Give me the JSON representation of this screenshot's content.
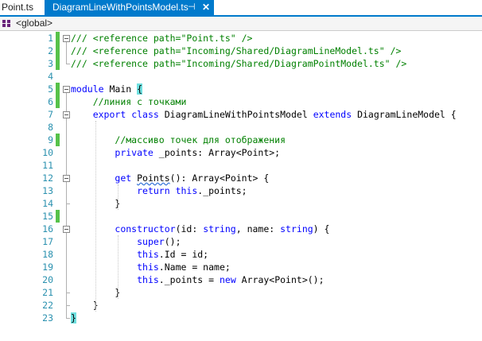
{
  "tabs": [
    {
      "label": "Point.ts",
      "active": false
    },
    {
      "label": "DiagramLineWithPointsModel.ts",
      "active": true,
      "pin": "⊣",
      "close": "✕"
    }
  ],
  "navbar": {
    "scope": "<global>"
  },
  "colors": {
    "keyword": "#0000ff",
    "comment": "#008000",
    "text": "#000000",
    "line_number": "#2b91af",
    "accent": "#007acc",
    "changed": "#57c24a"
  },
  "lines": [
    {
      "n": "1",
      "changed": true,
      "tokens": [
        [
          "c",
          "/// <reference path=\"Point.ts\" />"
        ]
      ]
    },
    {
      "n": "2",
      "changed": true,
      "tokens": [
        [
          "c",
          "/// <reference path=\"Incoming/Shared/DiagramLineModel.ts\" />"
        ]
      ]
    },
    {
      "n": "3",
      "changed": true,
      "tokens": [
        [
          "c",
          "/// <reference path=\"Incoming/Shared/DiagramPointModel.ts\" />"
        ]
      ]
    },
    {
      "n": "4",
      "changed": false,
      "tokens": []
    },
    {
      "n": "5",
      "changed": true,
      "tokens": [
        [
          "k",
          "module"
        ],
        [
          "t",
          " Main "
        ],
        [
          "b",
          "{"
        ]
      ]
    },
    {
      "n": "6",
      "changed": true,
      "tokens": [
        [
          "t",
          "    "
        ],
        [
          "c",
          "//линия с точками"
        ]
      ]
    },
    {
      "n": "7",
      "changed": false,
      "tokens": [
        [
          "t",
          "    "
        ],
        [
          "k",
          "export"
        ],
        [
          "t",
          " "
        ],
        [
          "k",
          "class"
        ],
        [
          "t",
          " DiagramLineWithPointsModel "
        ],
        [
          "k",
          "extends"
        ],
        [
          "t",
          " DiagramLineModel {"
        ]
      ]
    },
    {
      "n": "8",
      "changed": false,
      "tokens": []
    },
    {
      "n": "9",
      "changed": true,
      "tokens": [
        [
          "t",
          "        "
        ],
        [
          "c",
          "//массиво точек для отображения"
        ]
      ]
    },
    {
      "n": "10",
      "changed": false,
      "tokens": [
        [
          "t",
          "        "
        ],
        [
          "k",
          "private"
        ],
        [
          "t",
          " _points: Array<Point>;"
        ]
      ]
    },
    {
      "n": "11",
      "changed": false,
      "tokens": []
    },
    {
      "n": "12",
      "changed": false,
      "tokens": [
        [
          "t",
          "        "
        ],
        [
          "k",
          "get"
        ],
        [
          "t",
          " "
        ],
        [
          "s",
          "Points"
        ],
        [
          "t",
          "(): Array<Point> {"
        ]
      ]
    },
    {
      "n": "13",
      "changed": false,
      "tokens": [
        [
          "t",
          "            "
        ],
        [
          "k",
          "return"
        ],
        [
          "t",
          " "
        ],
        [
          "k",
          "this"
        ],
        [
          "t",
          "._points;"
        ]
      ]
    },
    {
      "n": "14",
      "changed": false,
      "tokens": [
        [
          "t",
          "        }"
        ]
      ]
    },
    {
      "n": "15",
      "changed": true,
      "tokens": []
    },
    {
      "n": "16",
      "changed": false,
      "tokens": [
        [
          "t",
          "        "
        ],
        [
          "k",
          "constructor"
        ],
        [
          "t",
          "(id: "
        ],
        [
          "k",
          "string"
        ],
        [
          "t",
          ", name: "
        ],
        [
          "k",
          "string"
        ],
        [
          "t",
          ") {"
        ]
      ]
    },
    {
      "n": "17",
      "changed": false,
      "tokens": [
        [
          "t",
          "            "
        ],
        [
          "k",
          "super"
        ],
        [
          "t",
          "();"
        ]
      ]
    },
    {
      "n": "18",
      "changed": false,
      "tokens": [
        [
          "t",
          "            "
        ],
        [
          "k",
          "this"
        ],
        [
          "t",
          ".Id = id;"
        ]
      ]
    },
    {
      "n": "19",
      "changed": false,
      "tokens": [
        [
          "t",
          "            "
        ],
        [
          "k",
          "this"
        ],
        [
          "t",
          ".Name = name;"
        ]
      ]
    },
    {
      "n": "20",
      "changed": false,
      "tokens": [
        [
          "t",
          "            "
        ],
        [
          "k",
          "this"
        ],
        [
          "t",
          "._points = "
        ],
        [
          "k",
          "new"
        ],
        [
          "t",
          " Array<Point>();"
        ]
      ]
    },
    {
      "n": "21",
      "changed": false,
      "tokens": [
        [
          "t",
          "        }"
        ]
      ]
    },
    {
      "n": "22",
      "changed": false,
      "tokens": [
        [
          "t",
          "    }"
        ]
      ]
    },
    {
      "n": "23",
      "changed": false,
      "tokens": [
        [
          "b",
          "}"
        ]
      ]
    }
  ]
}
